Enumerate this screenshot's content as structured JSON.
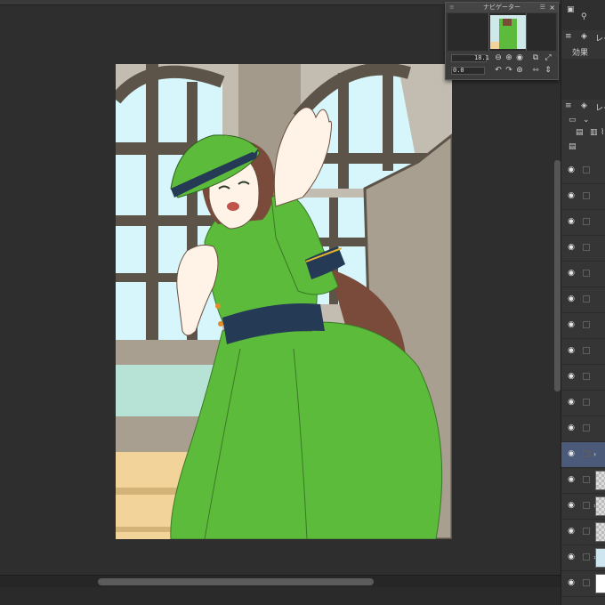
{
  "navigator": {
    "title": "ナビゲーター",
    "zoom_value": "18.1",
    "rotation_value": "0.0"
  },
  "right_panel": {
    "tab_layer_top": "レイ",
    "effects_label": "効果",
    "tab_layer_mid": "レイ"
  },
  "layers": {
    "count": 17,
    "selected_index": 11
  },
  "colors": {
    "selected_layer": "#4a5a78",
    "workspace": "#2e2e2e",
    "navigator_red_frame": "#d12a2a"
  },
  "canvas": {
    "subject": "illustration of a girl in a green dress and cap waving in front of arched windows"
  }
}
